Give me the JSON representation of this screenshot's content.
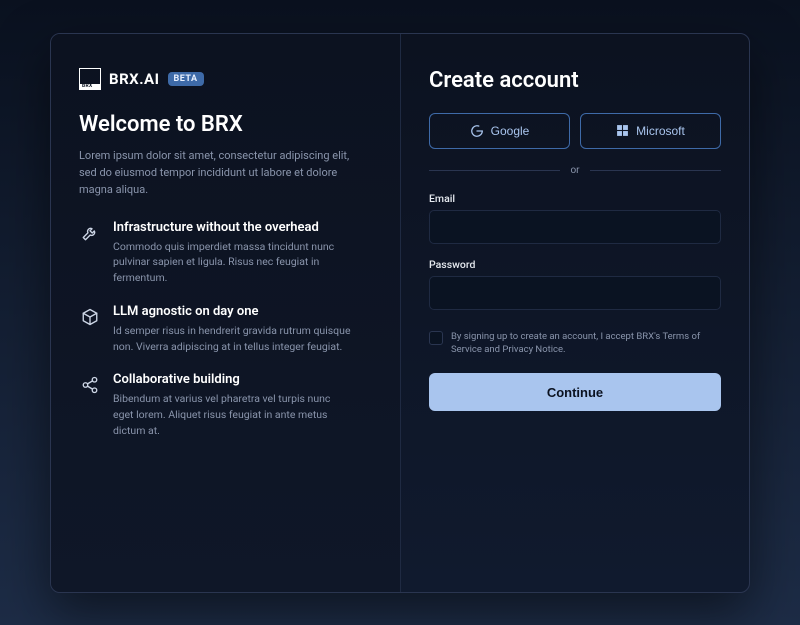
{
  "brand": {
    "mark_text": "BRX",
    "name": "BRX.AI",
    "badge": "BETA"
  },
  "left": {
    "welcome": "Welcome to BRX",
    "intro": "Lorem ipsum dolor sit amet, consectetur adipiscing elit, sed do eiusmod tempor incididunt ut labore et dolore magna aliqua.",
    "features": [
      {
        "title": "Infrastructure without the overhead",
        "body": "Commodo quis imperdiet massa tincidunt nunc pulvinar sapien et ligula. Risus nec feugiat in fermentum."
      },
      {
        "title": "LLM agnostic on day one",
        "body": "Id semper risus in hendrerit gravida rutrum quisque non. Viverra adipiscing at in tellus integer feugiat."
      },
      {
        "title": "Collaborative building",
        "body": "Bibendum at varius vel pharetra vel turpis nunc eget lorem. Aliquet risus feugiat in ante metus dictum at."
      }
    ]
  },
  "right": {
    "heading": "Create account",
    "oauth": {
      "google": "Google",
      "microsoft": "Microsoft"
    },
    "divider": "or",
    "email_label": "Email",
    "password_label": "Password",
    "terms": "By signing up to create an account, I accept BRX's Terms of Service and Privacy Notice.",
    "continue": "Continue"
  }
}
